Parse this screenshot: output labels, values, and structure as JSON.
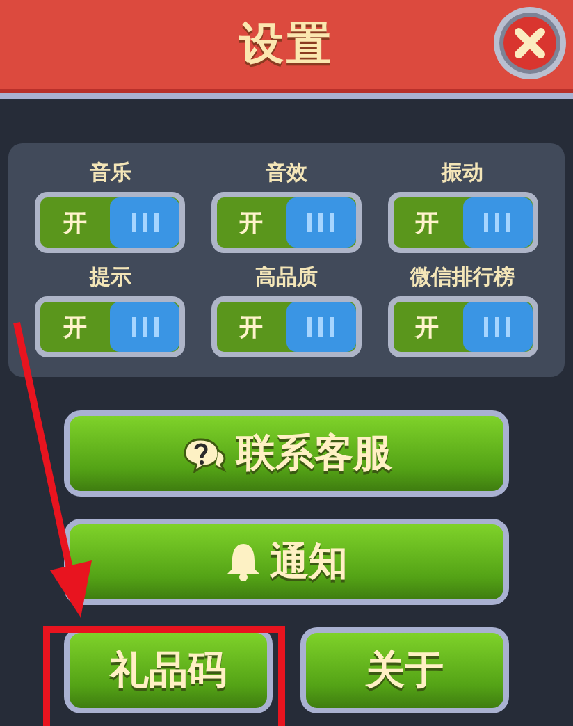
{
  "window": {
    "title": "设置"
  },
  "toggles": [
    {
      "label": "音乐",
      "state_text": "开",
      "on": true
    },
    {
      "label": "音效",
      "state_text": "开",
      "on": true
    },
    {
      "label": "振动",
      "state_text": "开",
      "on": true
    },
    {
      "label": "提示",
      "state_text": "开",
      "on": true
    },
    {
      "label": "高品质",
      "state_text": "开",
      "on": true
    },
    {
      "label": "微信排行榜",
      "state_text": "开",
      "on": true
    }
  ],
  "buttons": [
    {
      "label": "联系客服",
      "kind": "help"
    },
    {
      "label": "通知",
      "kind": "bell"
    }
  ],
  "bottom_buttons": [
    {
      "label": "礼品码",
      "highlighted": true
    },
    {
      "label": "关于",
      "highlighted": false
    }
  ]
}
